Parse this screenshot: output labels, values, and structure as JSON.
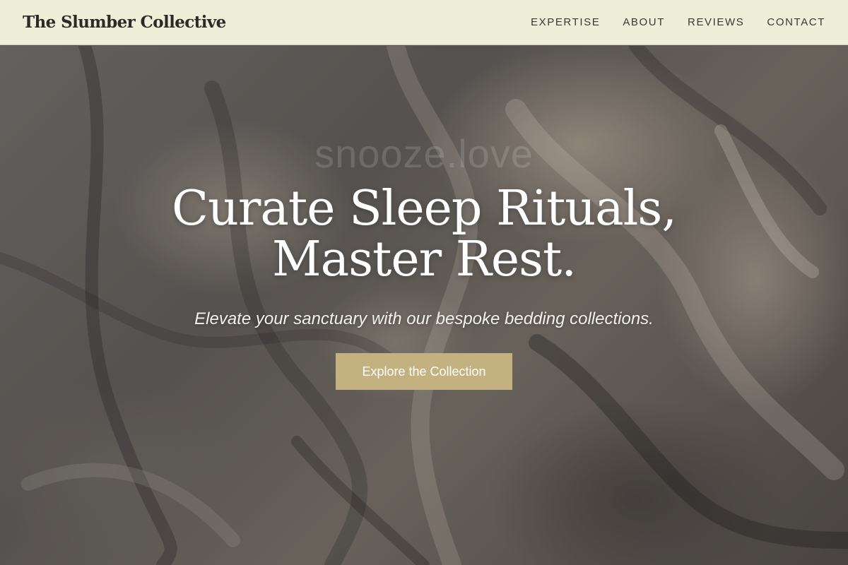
{
  "brand": {
    "name": "The Slumber Collective"
  },
  "nav": {
    "items": [
      {
        "label": "EXPERTISE"
      },
      {
        "label": "ABOUT"
      },
      {
        "label": "REVIEWS"
      },
      {
        "label": "CONTACT"
      }
    ]
  },
  "hero": {
    "headline_line1": "Curate Sleep Rituals,",
    "headline_line2": "Master Rest.",
    "watermark": "snooze.love",
    "subtitle": "Elevate your sanctuary with our bespoke bedding collections.",
    "cta_label": "Explore the Collection"
  },
  "colors": {
    "nav_background": "#efefd9",
    "cta_background": "#c3b17f",
    "headline_text": "#ffffff"
  }
}
